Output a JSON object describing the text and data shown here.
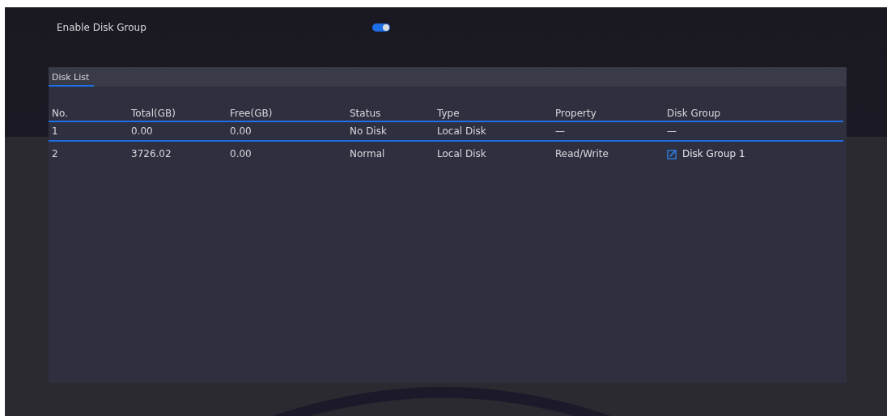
{
  "enable_disk_group": {
    "label": "Enable Disk Group",
    "on": true
  },
  "disk_list": {
    "title": "Disk List",
    "columns": [
      "No.",
      "Total(GB)",
      "Free(GB)",
      "Status",
      "Type",
      "Property",
      "Disk Group"
    ],
    "rows": [
      {
        "cells": [
          "1",
          "0.00",
          "0.00",
          "No Disk",
          "Local Disk",
          "—",
          "—"
        ],
        "editable": false
      },
      {
        "cells": [
          "2",
          "3726.02",
          "0.00",
          "Normal",
          "Local Disk",
          "Read/Write",
          "Disk Group 1"
        ],
        "editable": true
      }
    ]
  }
}
